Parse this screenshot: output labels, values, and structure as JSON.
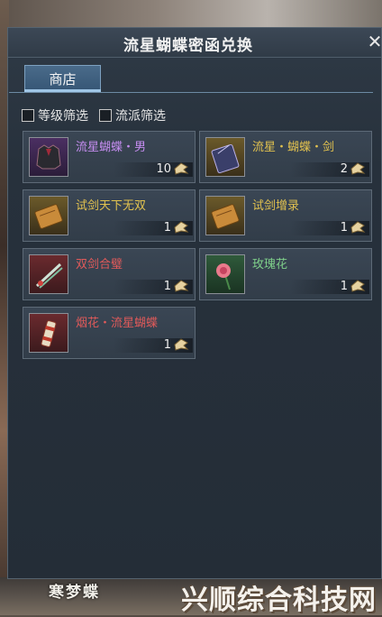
{
  "window": {
    "title": "流星蝴蝶密函兑换",
    "close_label": "✕"
  },
  "tabs": [
    {
      "label": "商店",
      "active": true
    }
  ],
  "filters": [
    {
      "label": "等级筛选",
      "checked": false
    },
    {
      "label": "流派筛选",
      "checked": false
    }
  ],
  "items": [
    {
      "name": "流星蝴蝶・男",
      "count": "10",
      "name_color": "#c58df0",
      "rarity": "purple",
      "icon": "armor-icon"
    },
    {
      "name": "流星・蝴蝶・剑",
      "count": "2",
      "name_color": "#e2c24f",
      "rarity": "gold",
      "icon": "book-icon"
    },
    {
      "name": "试剑天下无双",
      "count": "1",
      "name_color": "#e2c24f",
      "rarity": "gold",
      "icon": "scroll-icon"
    },
    {
      "name": "试剑增录",
      "count": "1",
      "name_color": "#e2c24f",
      "rarity": "gold",
      "icon": "scroll-icon"
    },
    {
      "name": "双剑合璧",
      "count": "1",
      "name_color": "#e05a5a",
      "rarity": "red",
      "icon": "twin-swords-icon"
    },
    {
      "name": "玫瑰花",
      "count": "1",
      "name_color": "#7fd08a",
      "rarity": "green",
      "icon": "rose-icon"
    },
    {
      "name": "烟花・流星蝴蝶",
      "count": "1",
      "name_color": "#e05a5a",
      "rarity": "red",
      "icon": "firework-icon"
    }
  ],
  "background": {
    "character_name": "寒梦蝶",
    "watermark": "兴顺综合科技网"
  }
}
